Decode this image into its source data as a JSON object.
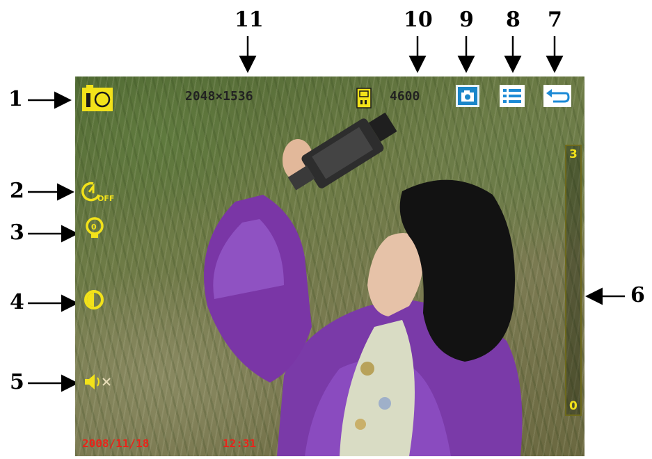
{
  "callouts": [
    "1",
    "2",
    "3",
    "4",
    "5",
    "6",
    "7",
    "8",
    "9",
    "10",
    "11"
  ],
  "viewfinder": {
    "resolution": "2048×1536",
    "remaining_shots": "4600",
    "date": "2008/11/18",
    "time": "12:31",
    "zoom": {
      "max_label": "3",
      "min_label": "0"
    }
  },
  "icons": {
    "mode": "camera-mode-icon",
    "self_timer": "self-timer-off-icon",
    "flash": "flash-icon",
    "exposure": "exposure-contrast-icon",
    "sound": "sound-muted-icon",
    "memory": "memory-card-icon",
    "capture": "camera-capture-icon",
    "menu": "menu-list-icon",
    "back": "back-return-icon"
  },
  "colors": {
    "osd_yellow": "#f2e21a",
    "icon_blue": "#1c8ad6",
    "date_red": "#e8241a"
  }
}
